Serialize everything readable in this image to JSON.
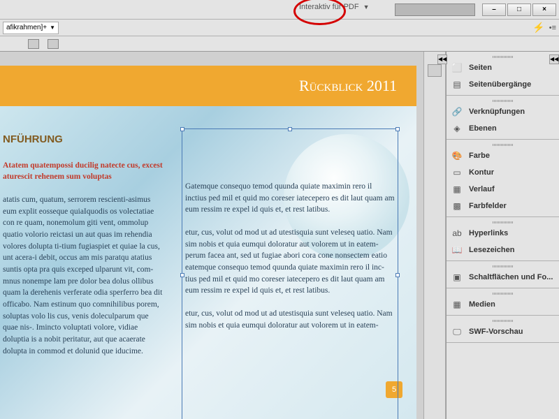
{
  "topbar": {
    "workspace": "Interaktiv für PDF",
    "window_buttons": {
      "min": "–",
      "max": "□",
      "close": "×"
    }
  },
  "toolbar2": {
    "frame_dropdown": "afikrahmen]+",
    "right_toggle": "•≡"
  },
  "document": {
    "header_title": "Rückblick 2011",
    "intro_heading": "NFÜHRUNG",
    "red_lead": "Atatem quatempossi ducilig natecte cus, excest aturescit rehenem sum voluptas",
    "col1_body": "atatis cum, quatum, serrorem rescienti-asimus eum explit eosseque quiaIquodis os volectatiae con re quam, nonemolum giti vent, ommolup quatio volorio reictasi un aut quas im rehendia volores dolupta ti-tium fugiaspiet et quiae la cus, unt acera-i debit, occus am mis paratqu atatius suntis opta pra quis exceped ulparunt vit, com-mnus nonempe lam pre dolor bea dolus ollibus quam la derehenis verferate odia sperferro bea dit officabo. Nam estinum quo comnihilibus porem, soluptas volo lis cus, venis doleculparum que quae nis-. Imincto voluptati volore, vidiae doluptia is a nobit peritatur, aut que acaerate dolupta in commod et dolunid que iducime.",
    "col2_p1": "Gatemque consequo temod quunda quiate maximin rero il inctius ped mil et quid mo coreser iatecepero es dit laut quam am eum ressim re expel id quis et, et rest latibus.",
    "col2_p2": "etur, cus, volut od mod ut ad utestisquia sunt veleseq uatio. Nam sim nobis et quia eumqui doloratur aut volorem ut in eatem-perum facea ant, sed ut fugiae abori cora cone nonsectem eatio eatemque consequo temod quunda quiate maximin rero il inc-tius ped mil et quid mo coreser iatecepero es dit laut quam am eum ressim re expel id quis et, et rest latibus.",
    "col2_p3": "etur, cus, volut od mod ut ad utestisquia sunt veleseq uatio. Nam sim nobis et quia eumqui doloratur aut volorem ut in eatem-",
    "page_number": "5"
  },
  "panels": [
    {
      "group": [
        {
          "icon": "⬜",
          "label": "Seiten"
        },
        {
          "icon": "▤",
          "label": "Seitenübergänge"
        }
      ]
    },
    {
      "group": [
        {
          "icon": "🔗",
          "label": "Verknüpfungen"
        },
        {
          "icon": "◈",
          "label": "Ebenen"
        }
      ]
    },
    {
      "group": [
        {
          "icon": "🎨",
          "label": "Farbe"
        },
        {
          "icon": "▭",
          "label": "Kontur"
        },
        {
          "icon": "▦",
          "label": "Verlauf"
        },
        {
          "icon": "▩",
          "label": "Farbfelder"
        }
      ]
    },
    {
      "group": [
        {
          "icon": "ab",
          "label": "Hyperlinks"
        },
        {
          "icon": "📖",
          "label": "Lesezeichen"
        }
      ]
    },
    {
      "group": [
        {
          "icon": "▣",
          "label": "Schaltflächen und Fo..."
        }
      ]
    },
    {
      "group": [
        {
          "icon": "▦",
          "label": "Medien"
        }
      ]
    },
    {
      "group": [
        {
          "icon": "🖵",
          "label": "SWF-Vorschau"
        }
      ]
    }
  ]
}
